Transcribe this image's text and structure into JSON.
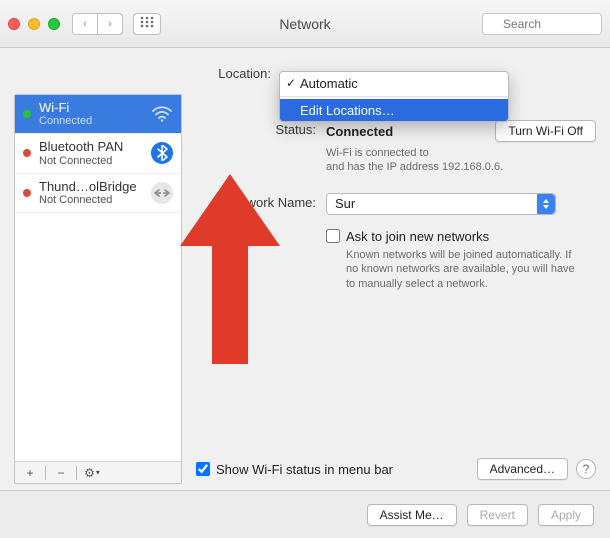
{
  "window": {
    "title": "Network",
    "search_placeholder": "Search"
  },
  "location": {
    "label": "Location:",
    "selected": "Automatic",
    "menu": {
      "item_automatic": "Automatic",
      "item_edit": "Edit Locations…"
    }
  },
  "sidebar": {
    "items": [
      {
        "name": "Wi-Fi",
        "sub": "Connected",
        "dot": "#2fbf3a",
        "icon_bg": "transparent",
        "icon_glyph": "wifi",
        "selected": true
      },
      {
        "name": "Bluetooth PAN",
        "sub": "Not Connected",
        "dot": "#d94b3f",
        "icon_bg": "#1e73e8",
        "icon_glyph": "bluetooth",
        "selected": false
      },
      {
        "name": "Thund…olBridge",
        "sub": "Not Connected",
        "dot": "#d94b3f",
        "icon_bg": "#e6e6e6",
        "icon_glyph": "thunderbolt",
        "selected": false
      }
    ],
    "footer": {
      "add": "+",
      "remove": "−",
      "gear": "⚙︎"
    }
  },
  "status": {
    "label": "Status:",
    "value": "Connected",
    "turn_off": "Turn Wi-Fi Off",
    "desc1": "Wi-Fi is connected to",
    "desc2": "and has the IP address 192.168.0.6."
  },
  "network_name": {
    "label": "Network Name:",
    "value": "Sur"
  },
  "ask_join": {
    "label": "Ask to join new networks",
    "note": "Known networks will be joined automatically. If no known networks are available, you will have to manually select a network."
  },
  "menubar": {
    "label": "Show Wi-Fi status in menu bar",
    "checked": true
  },
  "buttons": {
    "advanced": "Advanced…",
    "assist": "Assist Me…",
    "revert": "Revert",
    "apply": "Apply"
  }
}
